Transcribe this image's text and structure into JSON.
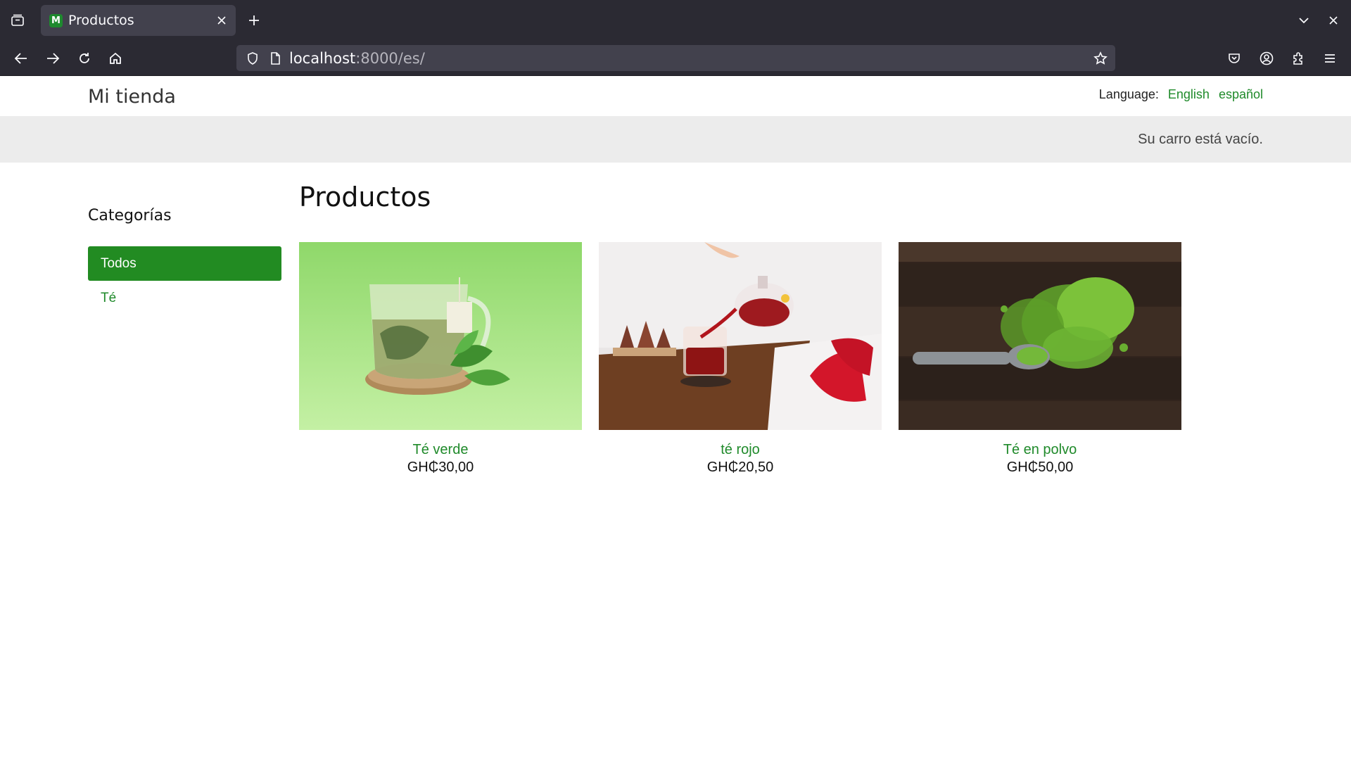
{
  "browser": {
    "tab": {
      "favicon_letter": "M",
      "title": "Productos"
    },
    "url": {
      "host": "localhost",
      "rest": ":8000/es/"
    },
    "icons": [
      "tab-list-icon",
      "close-icon",
      "new-tab-icon",
      "back-arrow-icon",
      "forward-arrow-icon",
      "reload-icon",
      "home-icon",
      "shield-icon",
      "page-icon",
      "bookmark-star-icon",
      "pocket-icon",
      "account-icon",
      "extensions-icon",
      "menu-icon",
      "tabs-overflow-chevron-icon",
      "window-close-icon"
    ]
  },
  "site": {
    "logo": "Mi tienda",
    "language": {
      "label": "Language:",
      "options": [
        "English",
        "español"
      ]
    },
    "cart_status": "Su carro está vacío."
  },
  "sidebar": {
    "title": "Categorías",
    "items": [
      {
        "label": "Todos",
        "active": true
      },
      {
        "label": "Té",
        "active": false
      }
    ]
  },
  "main": {
    "title": "Productos",
    "products": [
      {
        "name": "Té verde",
        "price": "GH₵30,00"
      },
      {
        "name": "té rojo",
        "price": "GH₵20,50"
      },
      {
        "name": "Té en polvo",
        "price": "GH₵50,00"
      }
    ]
  },
  "colors": {
    "chrome_bg": "#2b2a33",
    "tab_bg": "#42414d",
    "link_green": "#1f8a2a",
    "active_category": "#228b22",
    "cart_bar": "#ececec"
  }
}
